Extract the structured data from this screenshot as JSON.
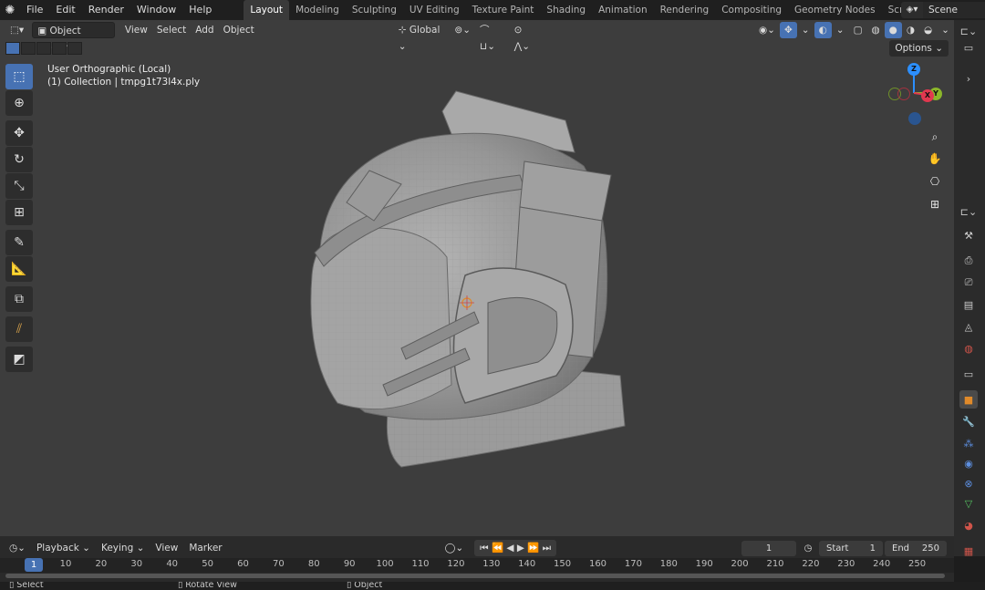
{
  "menu": {
    "items": [
      "File",
      "Edit",
      "Render",
      "Window",
      "Help"
    ]
  },
  "workspaces": {
    "tabs": [
      "Layout",
      "Modeling",
      "Sculpting",
      "UV Editing",
      "Texture Paint",
      "Shading",
      "Animation",
      "Rendering",
      "Compositing",
      "Geometry Nodes",
      "Scripting"
    ],
    "active": "Layout"
  },
  "scene": {
    "name": "Scene"
  },
  "viewport": {
    "mode": "Object Mode",
    "menus": [
      "View",
      "Select",
      "Add",
      "Object"
    ],
    "transform_orientation": "Global",
    "options_label": "Options",
    "view_name": "User Orthographic (Local)",
    "collection_info": "(1) Collection | tmpg1t73l4x.ply",
    "gizmo_axes": {
      "x": "X",
      "y": "Y",
      "z": "Z"
    },
    "colors": {
      "background": "#3d3d3d",
      "accent": "#4772b3",
      "x_axis": "#e0384f",
      "y_axis": "#8bb62a",
      "z_axis": "#2c8fff"
    }
  },
  "toolbar": {
    "tools": [
      "select-box",
      "cursor",
      "move",
      "rotate",
      "scale",
      "transform",
      "annotate",
      "measure",
      "add-cube",
      "knife",
      "extrude"
    ]
  },
  "timeline": {
    "menus": [
      "Playback",
      "Keying",
      "View",
      "Marker"
    ],
    "current_frame": "1",
    "start_label": "Start",
    "start": "1",
    "end_label": "End",
    "end": "250",
    "ruler_ticks": [
      "10",
      "20",
      "30",
      "40",
      "50",
      "60",
      "70",
      "80",
      "90",
      "100",
      "110",
      "120",
      "130",
      "140",
      "150",
      "160",
      "170",
      "180",
      "190",
      "200",
      "210",
      "220",
      "230",
      "240",
      "250"
    ],
    "current_tick": "1"
  },
  "statusbar": {
    "items": [
      "Select",
      "Rotate View",
      "Object"
    ]
  }
}
